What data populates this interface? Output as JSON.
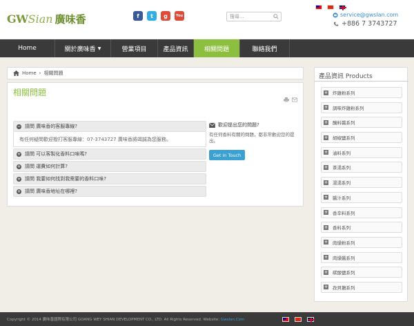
{
  "header": {
    "logo_latin": "GW",
    "logo_script": "Sian",
    "logo_chinese": "廣味香",
    "social": [
      {
        "icon": "facebook-icon",
        "glyph": "f"
      },
      {
        "icon": "twitter-icon",
        "glyph": "t"
      },
      {
        "icon": "google-plus-icon",
        "glyph": "g"
      },
      {
        "icon": "youtube-icon",
        "glyph": "You"
      }
    ],
    "search_placeholder": "搜尋...",
    "email": "service@gwslan.com",
    "phone": "+886 7 3743727"
  },
  "nav": {
    "items": [
      {
        "label": "Home"
      },
      {
        "label": "關於廣味香"
      },
      {
        "label": "營業項目"
      },
      {
        "label": "產品資訊"
      },
      {
        "label": "相關問題"
      },
      {
        "label": "聯絡我們"
      }
    ],
    "active": "相關問題"
  },
  "breadcrumb": {
    "home": "Home",
    "separator": "›",
    "current": "相關問題"
  },
  "page": {
    "title": "相關問題",
    "faqs": [
      {
        "question": "請問 廣味香的客服專線?",
        "answer": "有任何疑問歡迎撥打客服專線：07-3743727 廣味香將竭誠為您服務。",
        "open": true
      },
      {
        "question": "請問 可以客製化香料口味嗎?"
      },
      {
        "question": "請問 運費如何計算?"
      },
      {
        "question": "請問 我要如何找到我需要的香料口味?"
      },
      {
        "question": "請問 廣味香地址在哪裡?"
      }
    ],
    "ask": {
      "title": "歡迎提出您的問題?",
      "desc": "有任何香料有關的問題，都非常歡迎您的提出。",
      "button": "Get in Touch"
    }
  },
  "sidebar": {
    "title": "產品資訊 Products",
    "items": [
      {
        "label": "炸雞粉系列"
      },
      {
        "label": "調味炸雞粉系列"
      },
      {
        "label": "醃料醬系列"
      },
      {
        "label": "胡椒鹽系列"
      },
      {
        "label": "滷料系列"
      },
      {
        "label": "茶湯系列"
      },
      {
        "label": "湯湯系列"
      },
      {
        "label": "醬汁系列"
      },
      {
        "label": "香辛料系列"
      },
      {
        "label": "香料系列"
      },
      {
        "label": "肉燥粉系列"
      },
      {
        "label": "肉燥醬系列"
      },
      {
        "label": "碳酸鹽系列"
      },
      {
        "label": "孜貝鵝系列"
      }
    ]
  },
  "footer": {
    "copyright": "Copyright © 2014 廣味香國際有限公司 GOANG WEY SHIAN DEVELOPMENT CO., LTD. All Rights Reserved. Website:",
    "website": "Gwslan.Com"
  },
  "colors": {
    "accent": "#8cbf3f",
    "nav_bg": "#3a3a3a",
    "link": "#3aa1d1"
  }
}
